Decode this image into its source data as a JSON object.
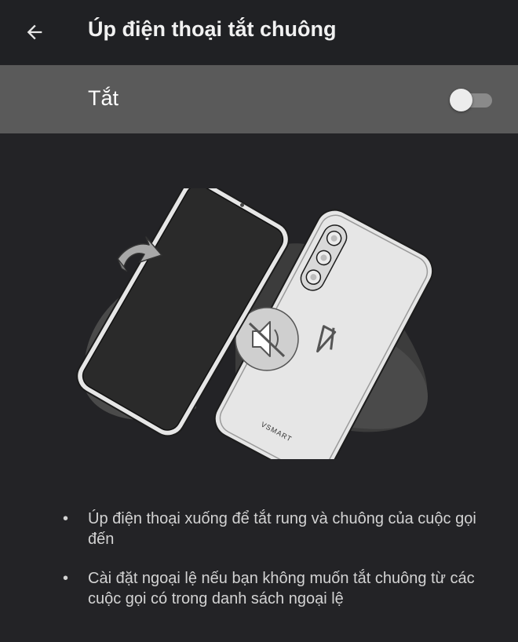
{
  "app_bar": {
    "title": "Úp điện thoại tắt chuông",
    "back_icon": "arrow-back-icon"
  },
  "toggle": {
    "label": "Tắt",
    "state": "off"
  },
  "illustration": {
    "brand_text": "VSMART",
    "icons": [
      "flip-arrow-icon",
      "mute-icon",
      "vsmart-logo-icon"
    ]
  },
  "bullets": [
    "Úp điện thoại xuống để tắt rung và chuông của cuộc gọi đến",
    "Cài đặt ngoại lệ nếu bạn không muốn tắt chuông từ các cuộc gọi có trong danh sách ngoại lệ"
  ],
  "colors": {
    "background": "#232326",
    "toggle_row": "#5a5a5a",
    "text": "#ffffff",
    "secondary_text": "#d3d3d3"
  }
}
